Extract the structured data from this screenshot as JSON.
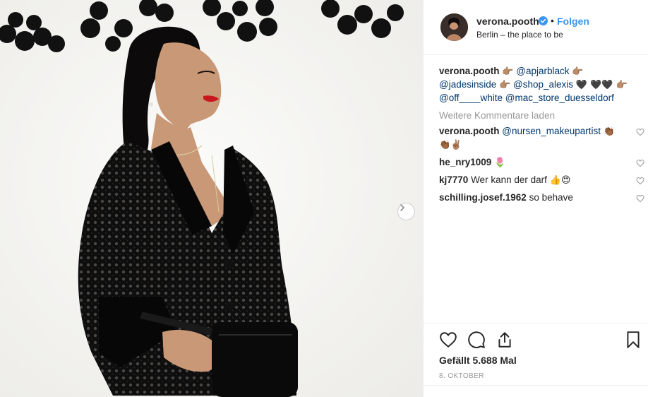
{
  "post": {
    "author": {
      "username": "verona.pooth",
      "location": "Berlin – the place to be",
      "follow_label": "Folgen",
      "separator": "•"
    },
    "caption": {
      "username": "verona.pooth",
      "parts": [
        {
          "type": "emoji",
          "text": "👉🏽"
        },
        {
          "type": "mention",
          "text": "@apjarblack"
        },
        {
          "type": "emoji",
          "text": "👉🏽"
        },
        {
          "type": "mention",
          "text": "@jadesinside"
        },
        {
          "type": "emoji",
          "text": "👉🏽"
        },
        {
          "type": "mention",
          "text": "@shop_alexis"
        },
        {
          "type": "emoji",
          "text": "🖤 🖤🖤 👉🏽"
        },
        {
          "type": "mention",
          "text": "@off____white"
        },
        {
          "type": "mention",
          "text": "@mac_store_duesseldorf"
        }
      ]
    },
    "load_more_label": "Weitere Kommentare laden",
    "comments": [
      {
        "username": "verona.pooth",
        "mention": "@nursen_makeupartist",
        "text": "",
        "emoji": "👏🏾👏🏾✌🏽"
      },
      {
        "username": "he_nry1009",
        "mention": "",
        "text": "",
        "emoji": "🌷"
      },
      {
        "username": "kj7770",
        "mention": "",
        "text": "Wer kann der darf",
        "emoji": "👍😍"
      },
      {
        "username": "schilling.josef.1962",
        "mention": "",
        "text": "so behave",
        "emoji": ""
      }
    ],
    "likes_label": "Gefällt 5.688 Mal",
    "date_label": "8. OKTOBER"
  },
  "colors": {
    "accent": "#3897f0",
    "mention": "#003569",
    "muted": "#999999",
    "border": "#efefef"
  },
  "icons": [
    "verified-badge-icon",
    "heart-icon",
    "comment-icon",
    "share-icon",
    "bookmark-icon",
    "chevron-right-icon"
  ]
}
